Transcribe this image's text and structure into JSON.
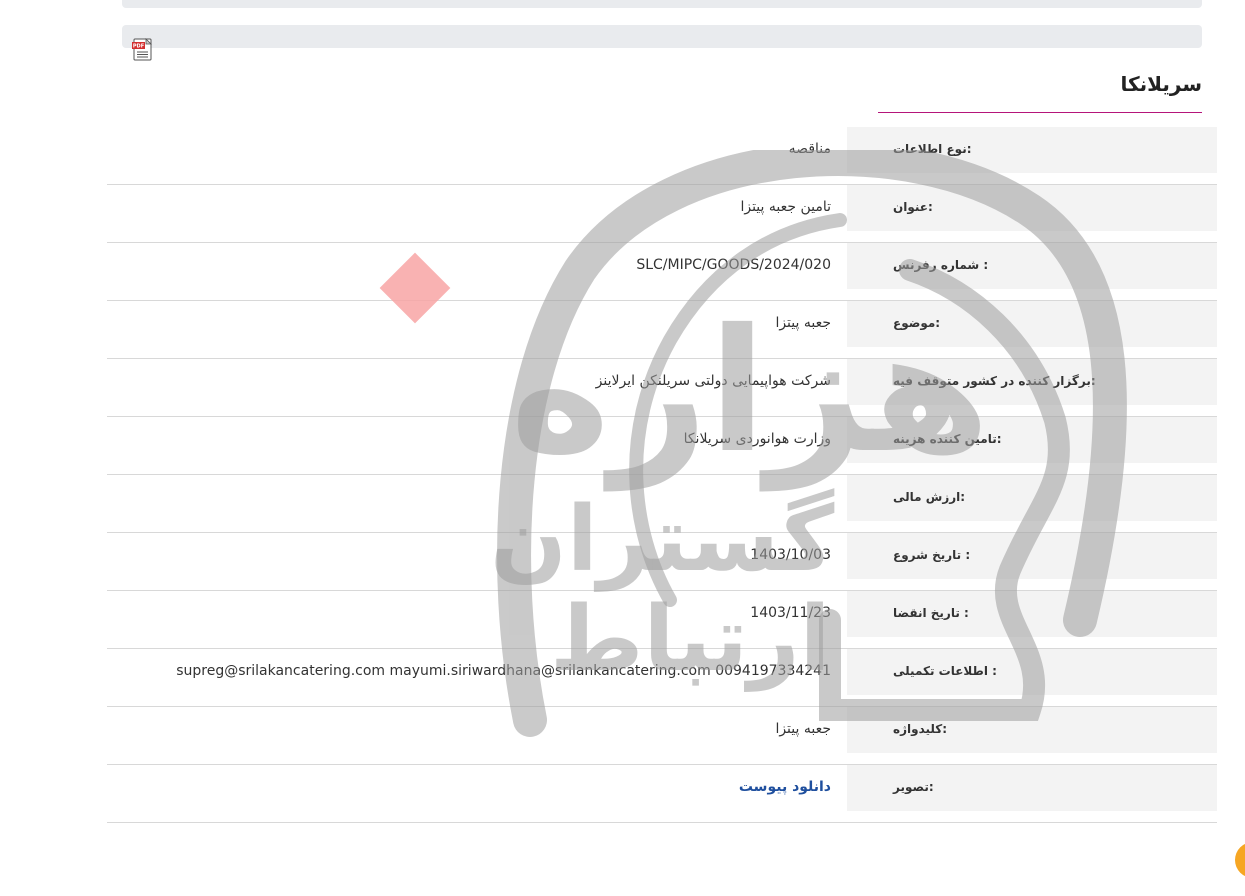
{
  "header": {
    "section_title": "سریلانکا",
    "pdf_icon": "pdf-file-icon"
  },
  "watermark": {
    "line1": "هزاره",
    "line2": "گستران",
    "line3": "ارتباط"
  },
  "info_rows": [
    {
      "label": "نوع اطلاعات:",
      "value": "مناقصه"
    },
    {
      "label": "عنوان:",
      "value": "تامین جعبه پیتزا"
    },
    {
      "label": "شماره رفرنس :",
      "value": "SLC/MIPC/GOODS/2024/020"
    },
    {
      "label": "موضوع:",
      "value": "جعبه پیتزا"
    },
    {
      "label": "برگزار کننده در کشور متوقف فیه:",
      "value": "شرکت هواپیمایی دولتی سریلنکن ایرلاینز"
    },
    {
      "label": "تامین کننده هزینه:",
      "value": "وزارت هوانوردی سریلانکا"
    },
    {
      "label": "ارزش مالی:",
      "value": ""
    },
    {
      "label": "تاریخ شروع :",
      "value": "1403/10/03"
    },
    {
      "label": "تاریخ انقضا :",
      "value": "1403/11/23"
    },
    {
      "label": "اطلاعات تکمیلی :",
      "value": "supreg@srilakancatering.com mayumi.siriwardhana@srilankancatering.com 0094197334241"
    },
    {
      "label": "کلیدواژه:",
      "value": "جعبه پیتزا"
    },
    {
      "label": "تصویر:",
      "value": "دانلود پیوست"
    }
  ],
  "colors": {
    "accent_underline": "#b5157a",
    "link": "#1f4f9e",
    "label_bg": "#f2f2f2",
    "top_bar_bg": "#e9ebee",
    "scroll_button": "#f6a623"
  }
}
